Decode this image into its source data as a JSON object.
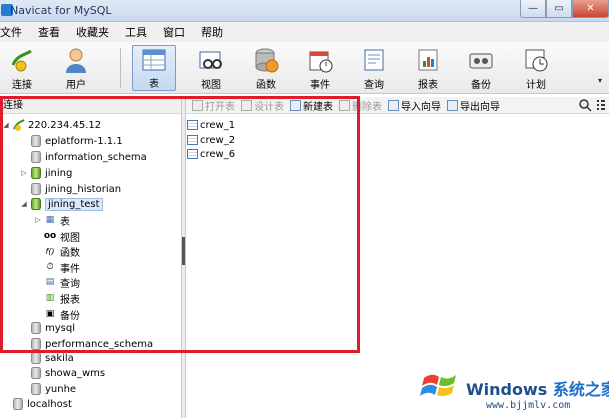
{
  "window": {
    "title": "Navicat for MySQL",
    "min": "—",
    "max": "▭",
    "close": "✕"
  },
  "menu": [
    "文件",
    "查看",
    "收藏夹",
    "工具",
    "窗口",
    "帮助"
  ],
  "toolbar": {
    "buttons": [
      {
        "label": "连接",
        "icon": "connection-icon"
      },
      {
        "label": "用户",
        "icon": "user-icon"
      },
      {
        "label": "表",
        "icon": "table-icon",
        "active": true
      },
      {
        "label": "视图",
        "icon": "view-icon"
      },
      {
        "label": "函数",
        "icon": "function-icon"
      },
      {
        "label": "事件",
        "icon": "event-icon"
      },
      {
        "label": "查询",
        "icon": "query-icon"
      },
      {
        "label": "报表",
        "icon": "report-icon"
      },
      {
        "label": "备份",
        "icon": "backup-icon"
      },
      {
        "label": "计划",
        "icon": "schedule-icon"
      }
    ]
  },
  "left_panel": {
    "header": "连接",
    "tree": [
      {
        "label": "220.234.45.12",
        "type": "connection",
        "toggle": "◢",
        "open": true
      },
      {
        "label": "eplatform-1.1.1",
        "type": "db"
      },
      {
        "label": "information_schema",
        "type": "db"
      },
      {
        "label": "jining",
        "type": "db-open",
        "toggle": "▷"
      },
      {
        "label": "jining_historian",
        "type": "db"
      },
      {
        "label": "jining_test",
        "type": "db-open",
        "toggle": "◢",
        "selected": true
      },
      {
        "label": "表",
        "type": "obj",
        "icon": "▦",
        "toggle": "▷"
      },
      {
        "label": "视图",
        "type": "obj",
        "icon": "oo"
      },
      {
        "label": "函数",
        "type": "obj",
        "icon": "f()"
      },
      {
        "label": "事件",
        "type": "obj",
        "icon": "⏱"
      },
      {
        "label": "查询",
        "type": "obj",
        "icon": "▤"
      },
      {
        "label": "报表",
        "type": "obj",
        "icon": "▥"
      },
      {
        "label": "备份",
        "type": "obj",
        "icon": "▣"
      },
      {
        "label": "mysql",
        "type": "db"
      },
      {
        "label": "performance_schema",
        "type": "db"
      },
      {
        "label": "sakila",
        "type": "db"
      },
      {
        "label": "showa_wms",
        "type": "db"
      },
      {
        "label": "yunhe",
        "type": "db"
      },
      {
        "label": "localhost",
        "type": "connection-root"
      }
    ]
  },
  "object_toolbar": [
    {
      "label": "打开表",
      "disabled": true
    },
    {
      "label": "设计表",
      "disabled": true
    },
    {
      "label": "新建表",
      "disabled": false
    },
    {
      "label": "删除表",
      "disabled": true
    },
    {
      "label": "导入向导",
      "disabled": false
    },
    {
      "label": "导出向导",
      "disabled": false
    }
  ],
  "tables": [
    "crew_1",
    "crew_2",
    "crew_6"
  ],
  "watermark": {
    "brand": "Windows",
    "brand_cn": "系统之家",
    "url": "www.bjjmlv.com"
  },
  "colors": {
    "annotation": "#e01b2c",
    "selection": "#dbe8f8"
  }
}
